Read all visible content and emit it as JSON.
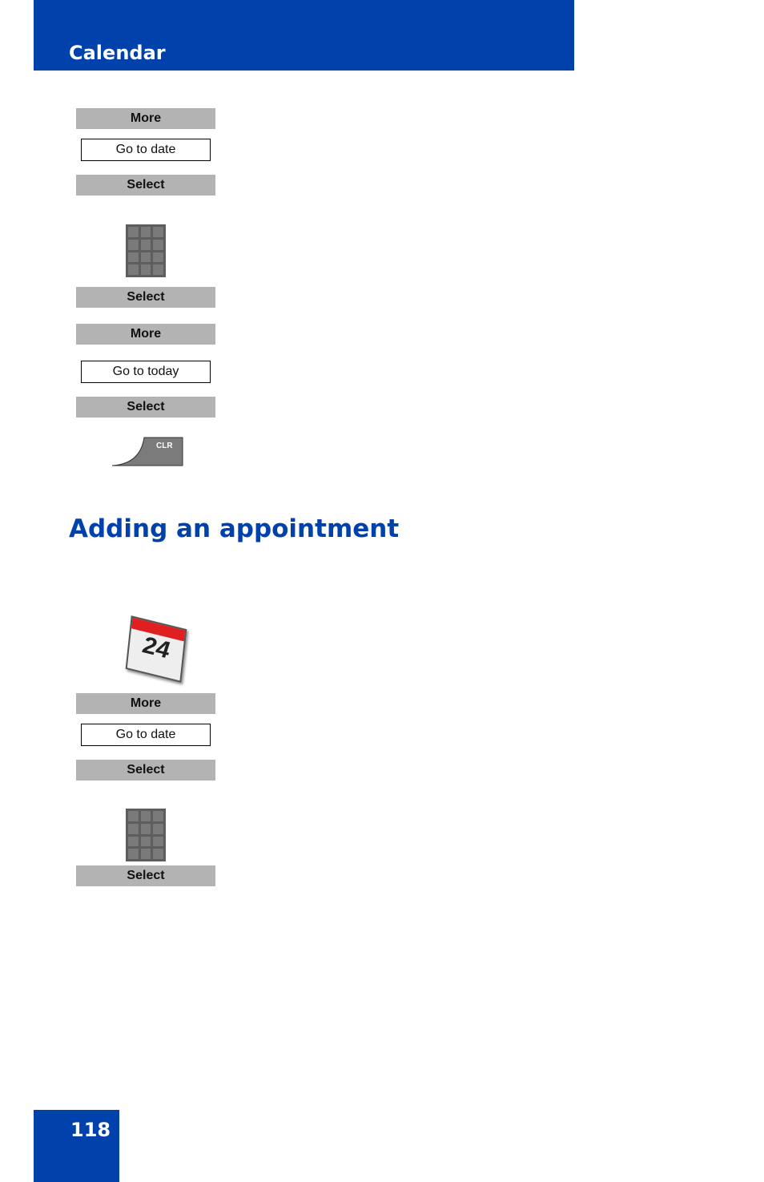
{
  "header": {
    "title": "Calendar"
  },
  "steps1": {
    "more1": "More",
    "goto_date": "Go to date",
    "select1": "Select",
    "select2": "Select",
    "more2": "More",
    "goto_today": "Go to today",
    "select3": "Select",
    "clr_key": "CLR"
  },
  "section": {
    "title": "Adding an appointment"
  },
  "steps2": {
    "calendar_day": "24",
    "more": "More",
    "goto_date": "Go to date",
    "select1": "Select",
    "select2": "Select"
  },
  "footer": {
    "page_number": "118"
  }
}
